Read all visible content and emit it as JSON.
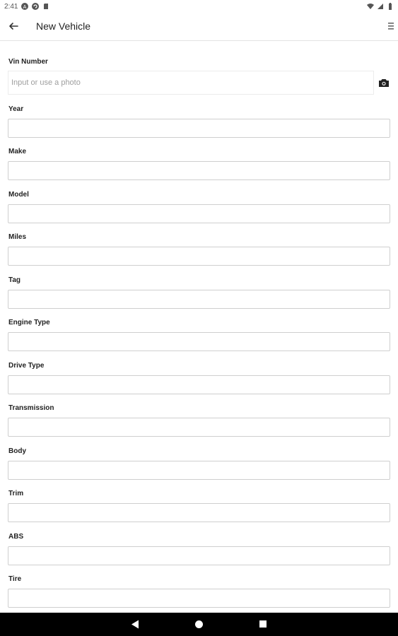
{
  "status_bar": {
    "time": "2:41",
    "icons": [
      "a-icon",
      "sync-icon",
      "sd-card-icon",
      "wifi-icon",
      "signal-icon",
      "battery-icon"
    ]
  },
  "app_bar": {
    "title": "New Vehicle",
    "back_icon": "arrow-back-icon",
    "menu_icon": "menu-icon"
  },
  "form": {
    "vin": {
      "label": "Vin Number",
      "placeholder": "Input or use a photo",
      "value": "",
      "camera_icon": "camera-icon"
    },
    "fields": [
      {
        "label": "Year",
        "value": ""
      },
      {
        "label": "Make",
        "value": ""
      },
      {
        "label": "Model",
        "value": ""
      },
      {
        "label": "Miles",
        "value": ""
      },
      {
        "label": "Tag",
        "value": ""
      },
      {
        "label": "Engine Type",
        "value": ""
      },
      {
        "label": "Drive Type",
        "value": ""
      },
      {
        "label": "Transmission",
        "value": ""
      },
      {
        "label": "Body",
        "value": ""
      },
      {
        "label": "Trim",
        "value": ""
      },
      {
        "label": "ABS",
        "value": ""
      },
      {
        "label": "Tire",
        "value": ""
      }
    ]
  },
  "nav_bar": {
    "icons": [
      "nav-back-icon",
      "nav-home-icon",
      "nav-recents-icon"
    ]
  },
  "colors": {
    "input_border": "#cfcfcf",
    "nav_background": "#000000",
    "placeholder": "#9e9e9e"
  }
}
